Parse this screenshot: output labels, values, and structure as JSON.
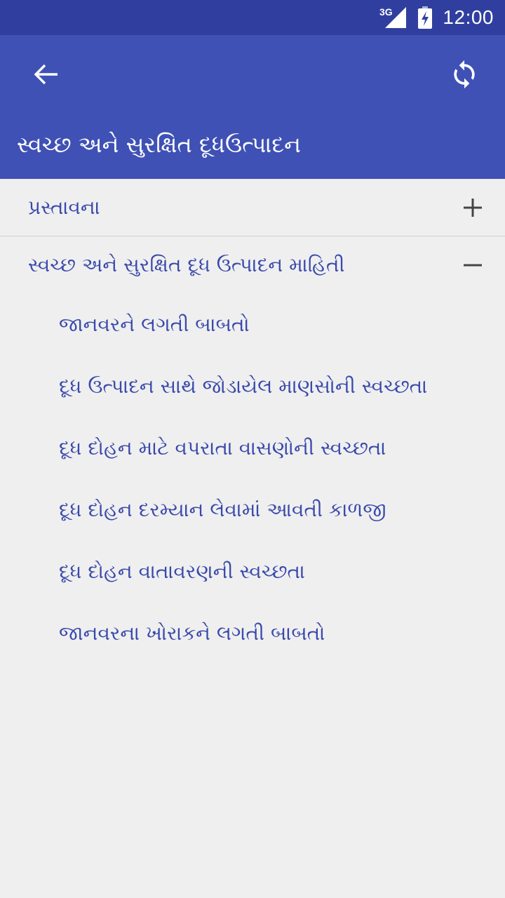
{
  "status_bar": {
    "network": "3G",
    "time": "12:00"
  },
  "app_bar": {
    "title": "સ્વચ્છ અને સુરક્ષિત દૂધઉત્પાદન",
    "back_icon": "arrow-back-icon",
    "refresh_icon": "refresh-icon"
  },
  "groups": [
    {
      "label": "પ્રસ્તાવના",
      "toggle": "+",
      "expanded": false
    },
    {
      "label": "સ્વચ્છ અને સુરક્ષિત દૂધ ઉત્પાદન માહિતી",
      "toggle": "−",
      "expanded": true,
      "children": [
        "જાનવરને લગતી બાબતો",
        "દૂધ ઉત્પાદન સાથે જોડાયેલ માણસોની સ્વચ્છતા",
        "દૂધ દોહન માટે વપરાતા વાસણોની સ્વચ્છતા",
        "દૂધ દોહન દરમ્યાન લેવામાં આવતી કાળજી",
        "દૂધ દોહન વાતાવરણની સ્વચ્છતા",
        "જાનવરના ખોરાકને લગતી બાબતો"
      ]
    }
  ],
  "colors": {
    "status_bar": "#303f9f",
    "app_bar": "#3f51b5",
    "link_text": "#3949ab",
    "background": "#efefef"
  }
}
